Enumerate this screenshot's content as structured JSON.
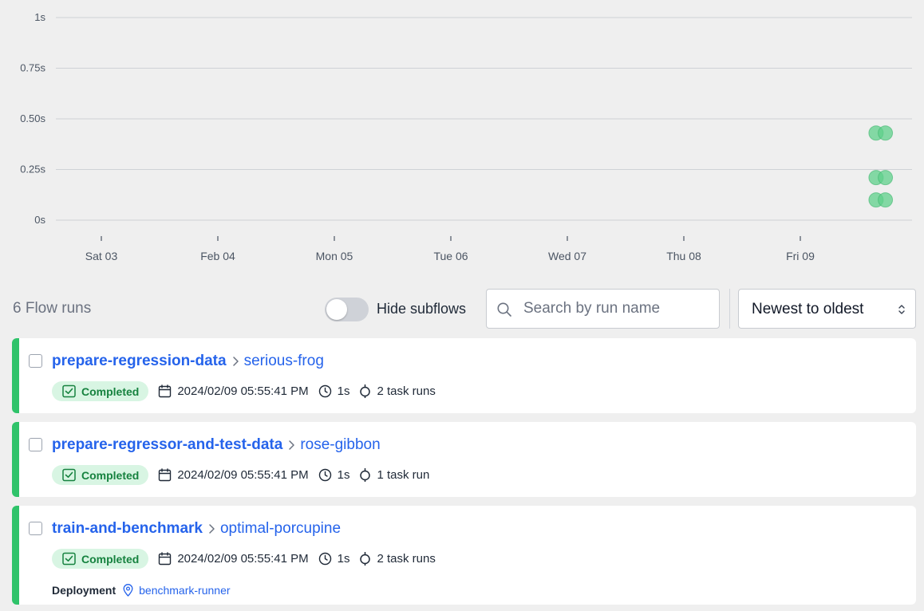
{
  "chart_data": {
    "type": "scatter",
    "y_tick_labels": [
      "0s",
      "0.25s",
      "0.50s",
      "0.75s",
      "1s"
    ],
    "y_range": [
      0,
      1
    ],
    "x_tick_labels": [
      "Sat 03",
      "Feb 04",
      "Mon 05",
      "Tue 06",
      "Wed 07",
      "Thu 08",
      "Fri 09"
    ],
    "grid": true,
    "point_color": "#5fd08b",
    "points": [
      {
        "day": 7.65,
        "duration_s": 0.43
      },
      {
        "day": 7.73,
        "duration_s": 0.43
      },
      {
        "day": 7.65,
        "duration_s": 0.21
      },
      {
        "day": 7.73,
        "duration_s": 0.21
      },
      {
        "day": 7.65,
        "duration_s": 0.1
      },
      {
        "day": 7.73,
        "duration_s": 0.1
      }
    ]
  },
  "toolbar": {
    "count_label": "6 Flow runs",
    "hide_subflows_label": "Hide subflows",
    "hide_subflows_on": false,
    "search_placeholder": "Search by run name",
    "sort_value": "Newest to oldest"
  },
  "runs": [
    {
      "flow_name": "prepare-regression-data",
      "run_name": "serious-frog",
      "state": "Completed",
      "timestamp": "2024/02/09 05:55:41 PM",
      "duration": "1s",
      "task_runs": "2 task runs"
    },
    {
      "flow_name": "prepare-regressor-and-test-data",
      "run_name": "rose-gibbon",
      "state": "Completed",
      "timestamp": "2024/02/09 05:55:41 PM",
      "duration": "1s",
      "task_runs": "1 task run"
    },
    {
      "flow_name": "train-and-benchmark",
      "run_name": "optimal-porcupine",
      "state": "Completed",
      "timestamp": "2024/02/09 05:55:41 PM",
      "duration": "1s",
      "task_runs": "2 task runs",
      "deployment_label": "Deployment",
      "deployment_name": "benchmark-runner"
    }
  ],
  "colors": {
    "state_completed": "#2fc36a",
    "link": "#2563eb",
    "badge_bg": "#d8f5e3",
    "badge_text": "#16823f"
  },
  "icons": {
    "search": "search-icon",
    "sort": "chevron-updown-icon",
    "crumb": "chevron-right-icon",
    "state": "check-square-icon",
    "date": "calendar-icon",
    "duration": "clock-icon",
    "task_runs": "task-run-icon",
    "deployment": "map-pin-icon"
  }
}
